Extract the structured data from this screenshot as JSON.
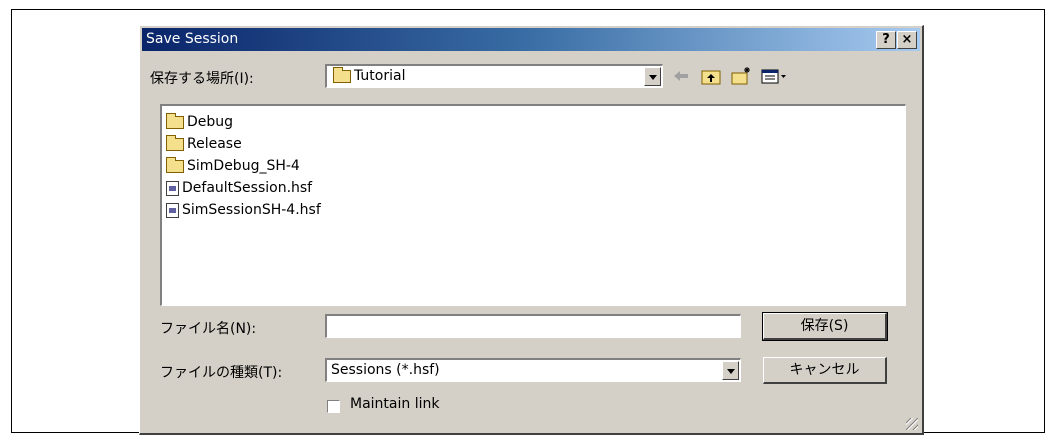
{
  "dialog": {
    "title": "Save Session",
    "help_label": "?",
    "close_label": "×"
  },
  "location": {
    "label": "保存する場所(I):",
    "value": "Tutorial"
  },
  "files": [
    {
      "name": "Debug",
      "type": "folder"
    },
    {
      "name": "Release",
      "type": "folder"
    },
    {
      "name": "SimDebug_SH-4",
      "type": "folder"
    },
    {
      "name": "DefaultSession.hsf",
      "type": "file"
    },
    {
      "name": "SimSessionSH-4.hsf",
      "type": "file"
    }
  ],
  "filename": {
    "label": "ファイル名(N):",
    "value": ""
  },
  "filetype": {
    "label": "ファイルの種類(T):",
    "value": "Sessions (*.hsf)"
  },
  "buttons": {
    "save": "保存(S)",
    "cancel": "キャンセル"
  },
  "maintain_link": {
    "label": "Maintain link",
    "checked": false
  },
  "colors": {
    "dialog_face": "#d4d0c8",
    "title_start": "#0a246a",
    "title_end": "#a6caf0"
  }
}
